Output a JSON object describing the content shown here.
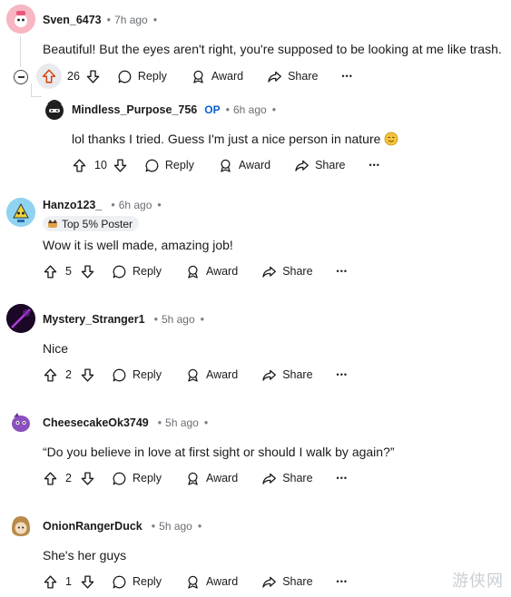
{
  "colors": {
    "upvote_active": "#d93a00",
    "op_badge": "#0a5fd0",
    "meta_gray": "#6a6f74"
  },
  "labels": {
    "reply": "Reply",
    "award": "Award",
    "share": "Share",
    "more": "•••",
    "sep": "•"
  },
  "comments": [
    {
      "author": "Sven_6473",
      "time": "7h ago",
      "text": "Beautiful! But the eyes aren't right, you're supposed to be looking at me like trash.",
      "votes": "26",
      "upvoted": true,
      "avatar": "sven-avatar-icon"
    },
    {
      "author": "Mindless_Purpose_756",
      "op": "OP",
      "time": "6h ago",
      "text": "lol thanks I tried. Guess I'm just a nice person in nature",
      "emoji": "smiling-face-icon",
      "votes": "10",
      "avatar": "mindless-avatar-icon"
    },
    {
      "author": "Hanzo123_",
      "time": "6h ago",
      "flair": "Top 5% Poster",
      "text": "Wow it is well made, amazing job!",
      "votes": "5",
      "avatar": "hanzo-avatar-icon"
    },
    {
      "author": "Mystery_Stranger1",
      "time": "5h ago",
      "text": "Nice",
      "votes": "2",
      "avatar": "mystery-avatar-icon"
    },
    {
      "author": "CheesecakeOk3749",
      "time": "5h ago",
      "text": "“Do you believe in love at first sight or should I walk by again?”",
      "votes": "2",
      "avatar": "cheesecake-avatar-icon"
    },
    {
      "author": "OnionRangerDuck",
      "time": "5h ago",
      "text": "She's her guys",
      "votes": "1",
      "avatar": "onion-avatar-icon"
    }
  ],
  "watermark": "游侠网"
}
